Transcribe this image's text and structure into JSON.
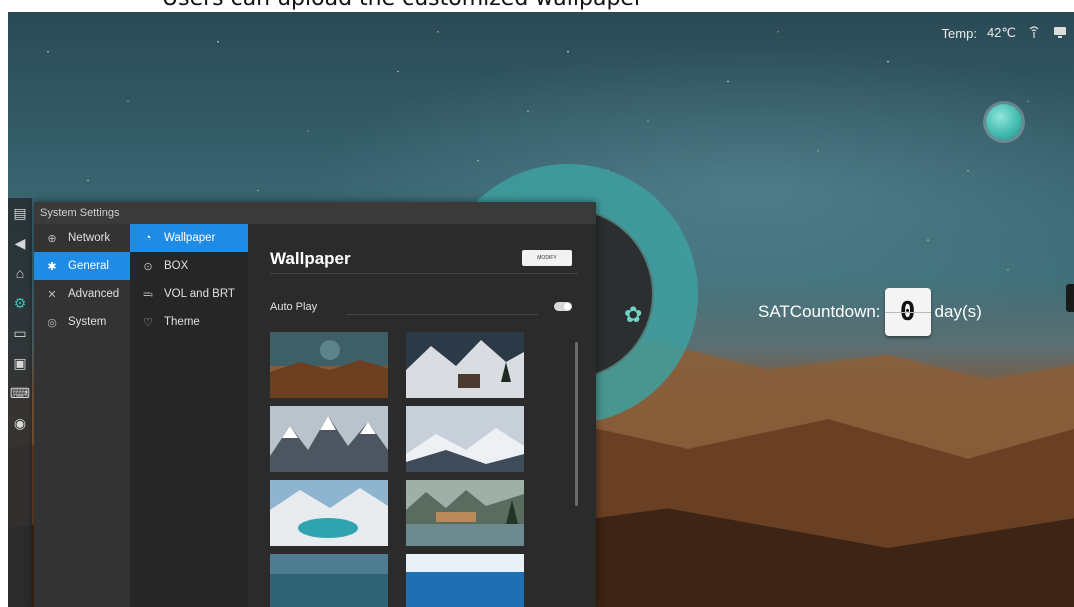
{
  "caption": "Users can upload the customized wallpaper",
  "status_bar": {
    "temp_label": "Temp:",
    "temp_value": "42℃",
    "icons": [
      "signal-icon",
      "monitor-icon"
    ]
  },
  "countdown": {
    "label": "SATCountdown:",
    "digit": "0",
    "unit": "day(s)"
  },
  "left_dock": {
    "icons": [
      "menu-icon",
      "back-icon",
      "home-icon",
      "settings-icon",
      "folder-icon",
      "screen-icon",
      "keyboard-icon",
      "power-icon"
    ]
  },
  "settings_panel": {
    "title": "System Settings",
    "categories": [
      {
        "label": "Network",
        "icon": "globe-icon",
        "active": false
      },
      {
        "label": "General",
        "icon": "gear-icon",
        "active": true
      },
      {
        "label": "Advanced",
        "icon": "tools-icon",
        "active": false
      },
      {
        "label": "System",
        "icon": "info-icon",
        "active": false
      }
    ],
    "subitems": [
      {
        "label": "Wallpaper",
        "icon": "image-icon",
        "active": true
      },
      {
        "label": "BOX",
        "icon": "radio-icon",
        "active": false
      },
      {
        "label": "VOL and BRT",
        "icon": "sliders-icon",
        "active": false
      },
      {
        "label": "Theme",
        "icon": "shirt-icon",
        "active": false
      }
    ],
    "content": {
      "title": "Wallpaper",
      "modify_button": "MODIFY",
      "auto_play_label": "Auto Play",
      "auto_play_on": true,
      "thumbnails": [
        "desert-night",
        "snow-cabin",
        "mountain-peaks",
        "snowy-range",
        "glacier-lake",
        "lakeside-lodge",
        "ocean-bay",
        "sea-horizon"
      ]
    }
  }
}
